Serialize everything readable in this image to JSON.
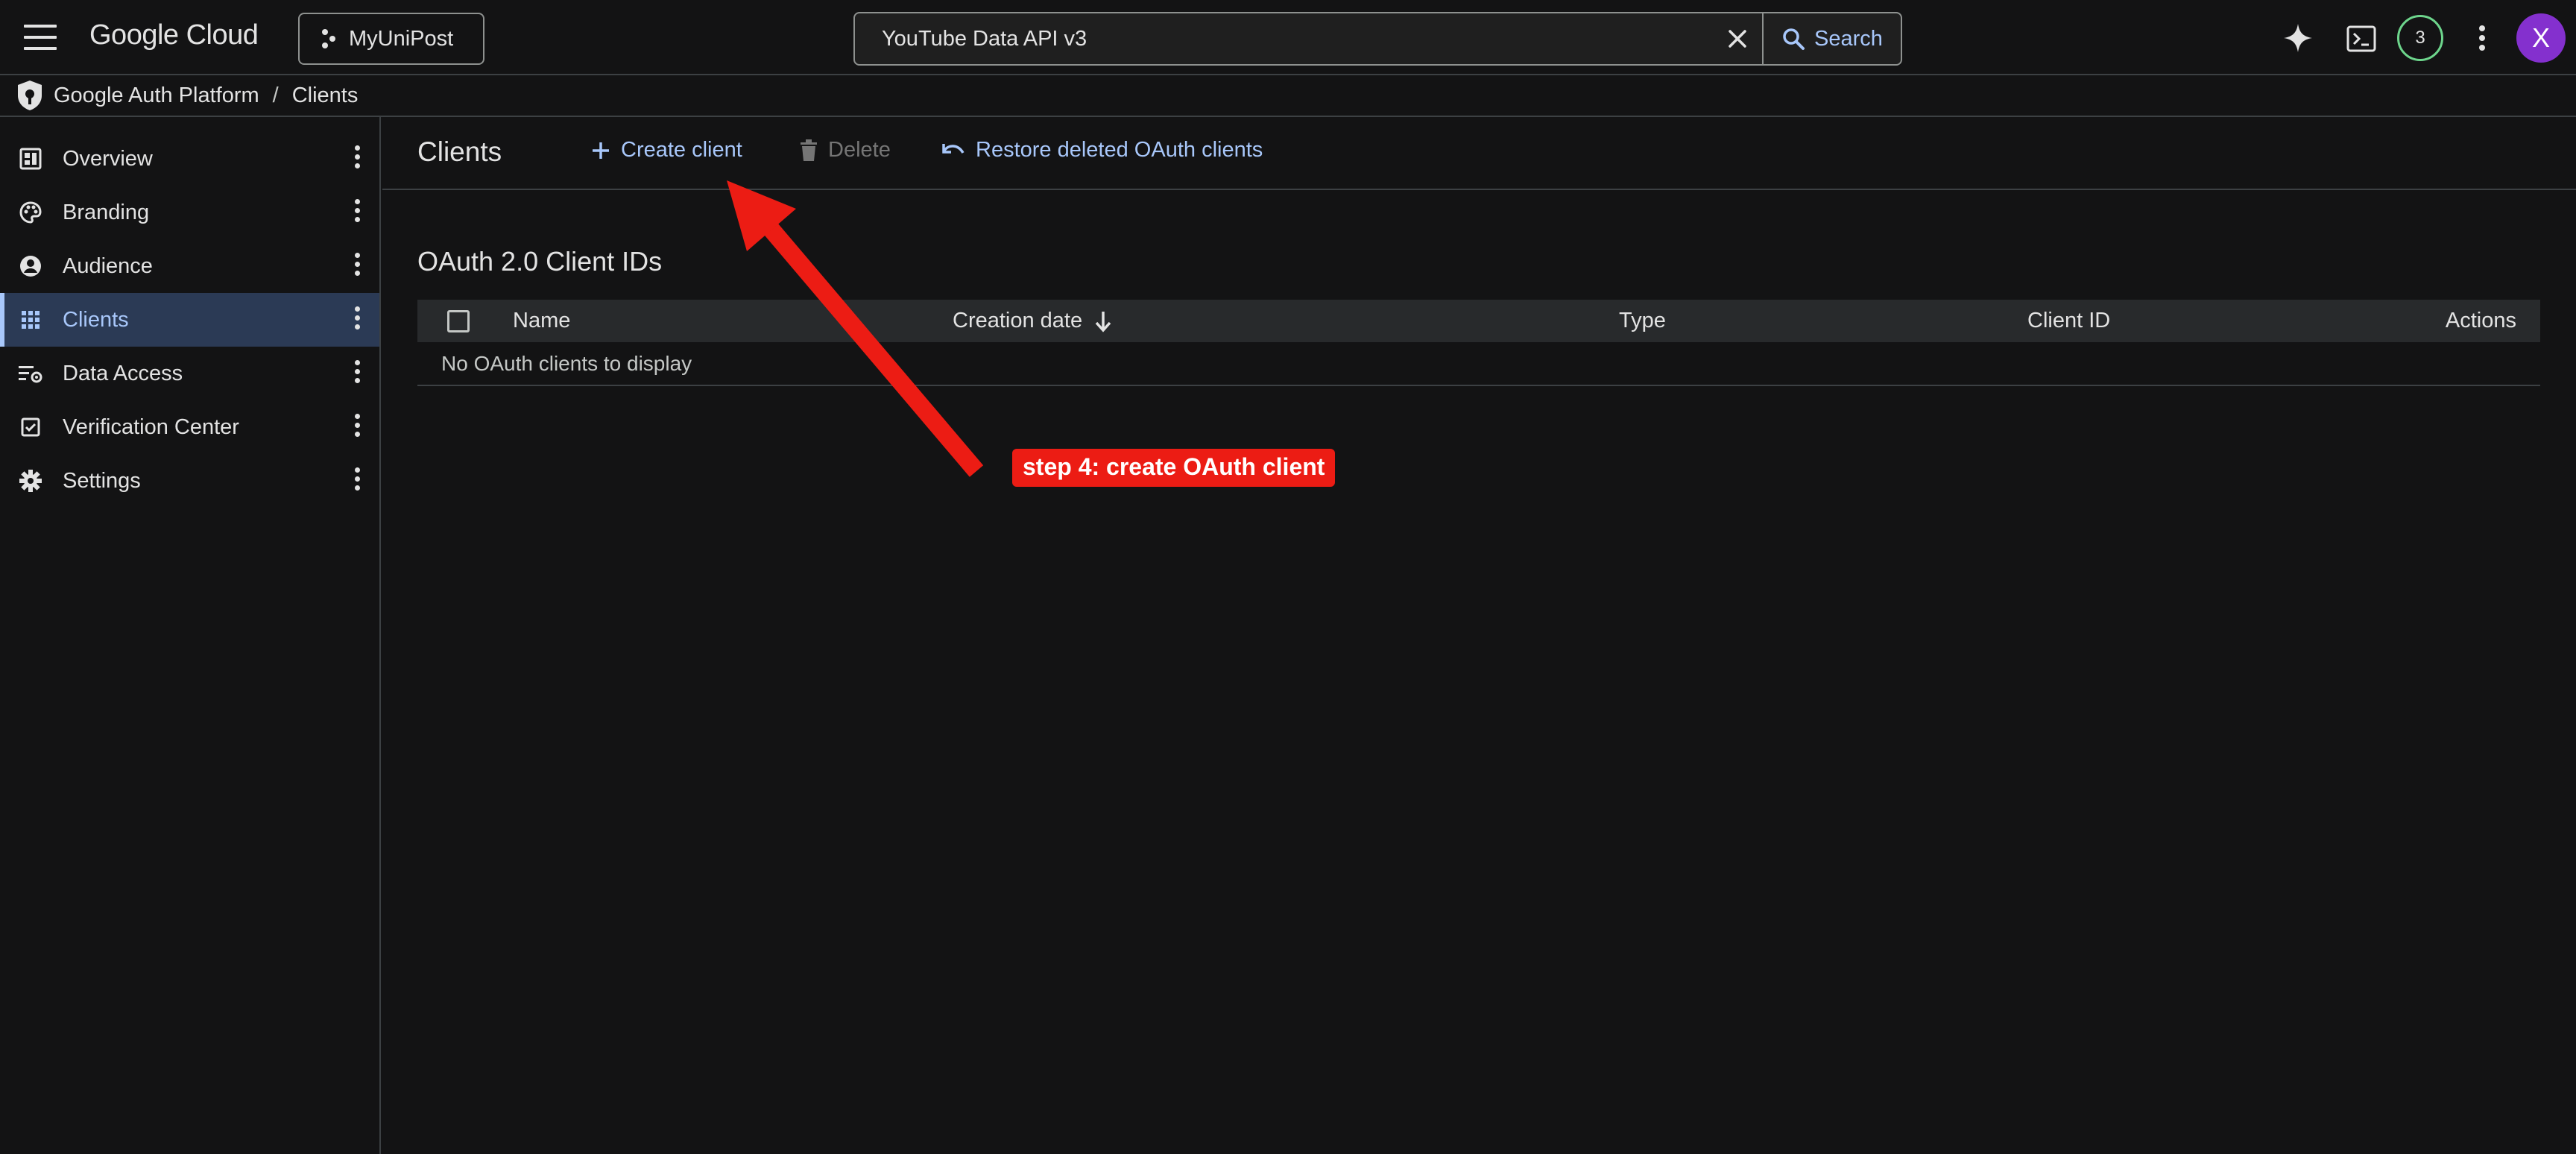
{
  "header": {
    "logo": "Google Cloud",
    "project": "MyUniPost",
    "search_value": "YouTube Data API v3",
    "search_label": "Search",
    "notification_count": "3",
    "avatar_initial": "X"
  },
  "breadcrumb": {
    "root": "Google Auth Platform",
    "separator": "/",
    "current": "Clients"
  },
  "sidebar": {
    "items": [
      {
        "label": "Overview",
        "icon": "dashboard-icon"
      },
      {
        "label": "Branding",
        "icon": "palette-icon"
      },
      {
        "label": "Audience",
        "icon": "person-icon"
      },
      {
        "label": "Clients",
        "icon": "apps-grid-icon",
        "active": true
      },
      {
        "label": "Data Access",
        "icon": "data-access-icon"
      },
      {
        "label": "Verification Center",
        "icon": "verified-checkbox-icon"
      },
      {
        "label": "Settings",
        "icon": "gear-icon"
      }
    ]
  },
  "main": {
    "title": "Clients",
    "actions": {
      "create": "Create client",
      "delete": "Delete",
      "restore": "Restore deleted OAuth clients"
    },
    "section_title": "OAuth 2.0 Client IDs",
    "table": {
      "columns": [
        "Name",
        "Creation date",
        "Type",
        "Client ID",
        "Actions"
      ],
      "empty_message": "No OAuth clients to display"
    }
  },
  "annotation": {
    "text": "step 4: create OAuth client",
    "color": "#ec1c14"
  },
  "colors": {
    "background": "#131314",
    "accent": "#a8c7fa",
    "active_nav_bg": "#2b3a55",
    "badge_ring": "#6dd58c",
    "avatar": "#8430ce"
  }
}
